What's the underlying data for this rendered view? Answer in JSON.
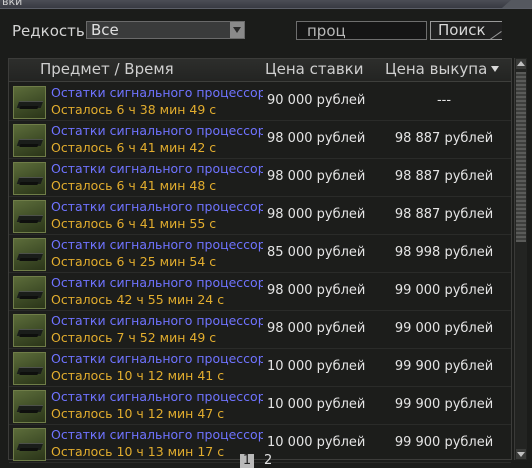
{
  "window": {
    "title": "вки"
  },
  "filter": {
    "rarity_label": "Редкость",
    "rarity_value": "Все",
    "search_value": "проц",
    "search_button": "Поиск"
  },
  "table": {
    "header": {
      "item_time": "Предмет   /   Время",
      "bid_price": "Цена ставки",
      "buyout_price": "Цена выкупа"
    },
    "rows": [
      {
        "name": "Остатки сигнального процессор..",
        "time": "Осталось 6 ч 38 мин 49 с",
        "bid": "90 000 рублей",
        "buyout": "---"
      },
      {
        "name": "Остатки сигнального процессор..",
        "time": "Осталось 6 ч 41 мин 42 с",
        "bid": "98 000 рублей",
        "buyout": "98 887 рублей"
      },
      {
        "name": "Остатки сигнального процессор..",
        "time": "Осталось 6 ч 41 мин 48 с",
        "bid": "98 000 рублей",
        "buyout": "98 887 рублей"
      },
      {
        "name": "Остатки сигнального процессор..",
        "time": "Осталось 6 ч 41 мин 55 с",
        "bid": "98 000 рублей",
        "buyout": "98 887 рублей"
      },
      {
        "name": "Остатки сигнального процессор..",
        "time": "Осталось 6 ч 25 мин 54 с",
        "bid": "85 000 рублей",
        "buyout": "98 998 рублей"
      },
      {
        "name": "Остатки сигнального процессор..",
        "time": "Осталось 42 ч 55 мин 24 с",
        "bid": "98 000 рублей",
        "buyout": "99 000 рублей"
      },
      {
        "name": "Остатки сигнального процессор..",
        "time": "Осталось 7 ч 52 мин 49 с",
        "bid": "98 000 рублей",
        "buyout": "99 000 рублей"
      },
      {
        "name": "Остатки сигнального процессор..",
        "time": "Осталось 10 ч 12 мин 41 с",
        "bid": "10 000 рублей",
        "buyout": "99 900 рублей"
      },
      {
        "name": "Остатки сигнального процессор..",
        "time": "Осталось 10 ч 12 мин 47 с",
        "bid": "10 000 рублей",
        "buyout": "99 900 рублей"
      },
      {
        "name": "Остатки сигнального процессор..",
        "time": "Осталось 10 ч 13 мин 17 с",
        "bid": "10 000 рублей",
        "buyout": "99 900 рублей"
      }
    ]
  },
  "pagination": {
    "page1": "1",
    "page2": "2"
  },
  "icons": {
    "item": "processor-chip-icon",
    "sort": "sort-descending-icon"
  },
  "colors": {
    "item_name": "#6f73ff",
    "time_left": "#e2ad2e"
  }
}
